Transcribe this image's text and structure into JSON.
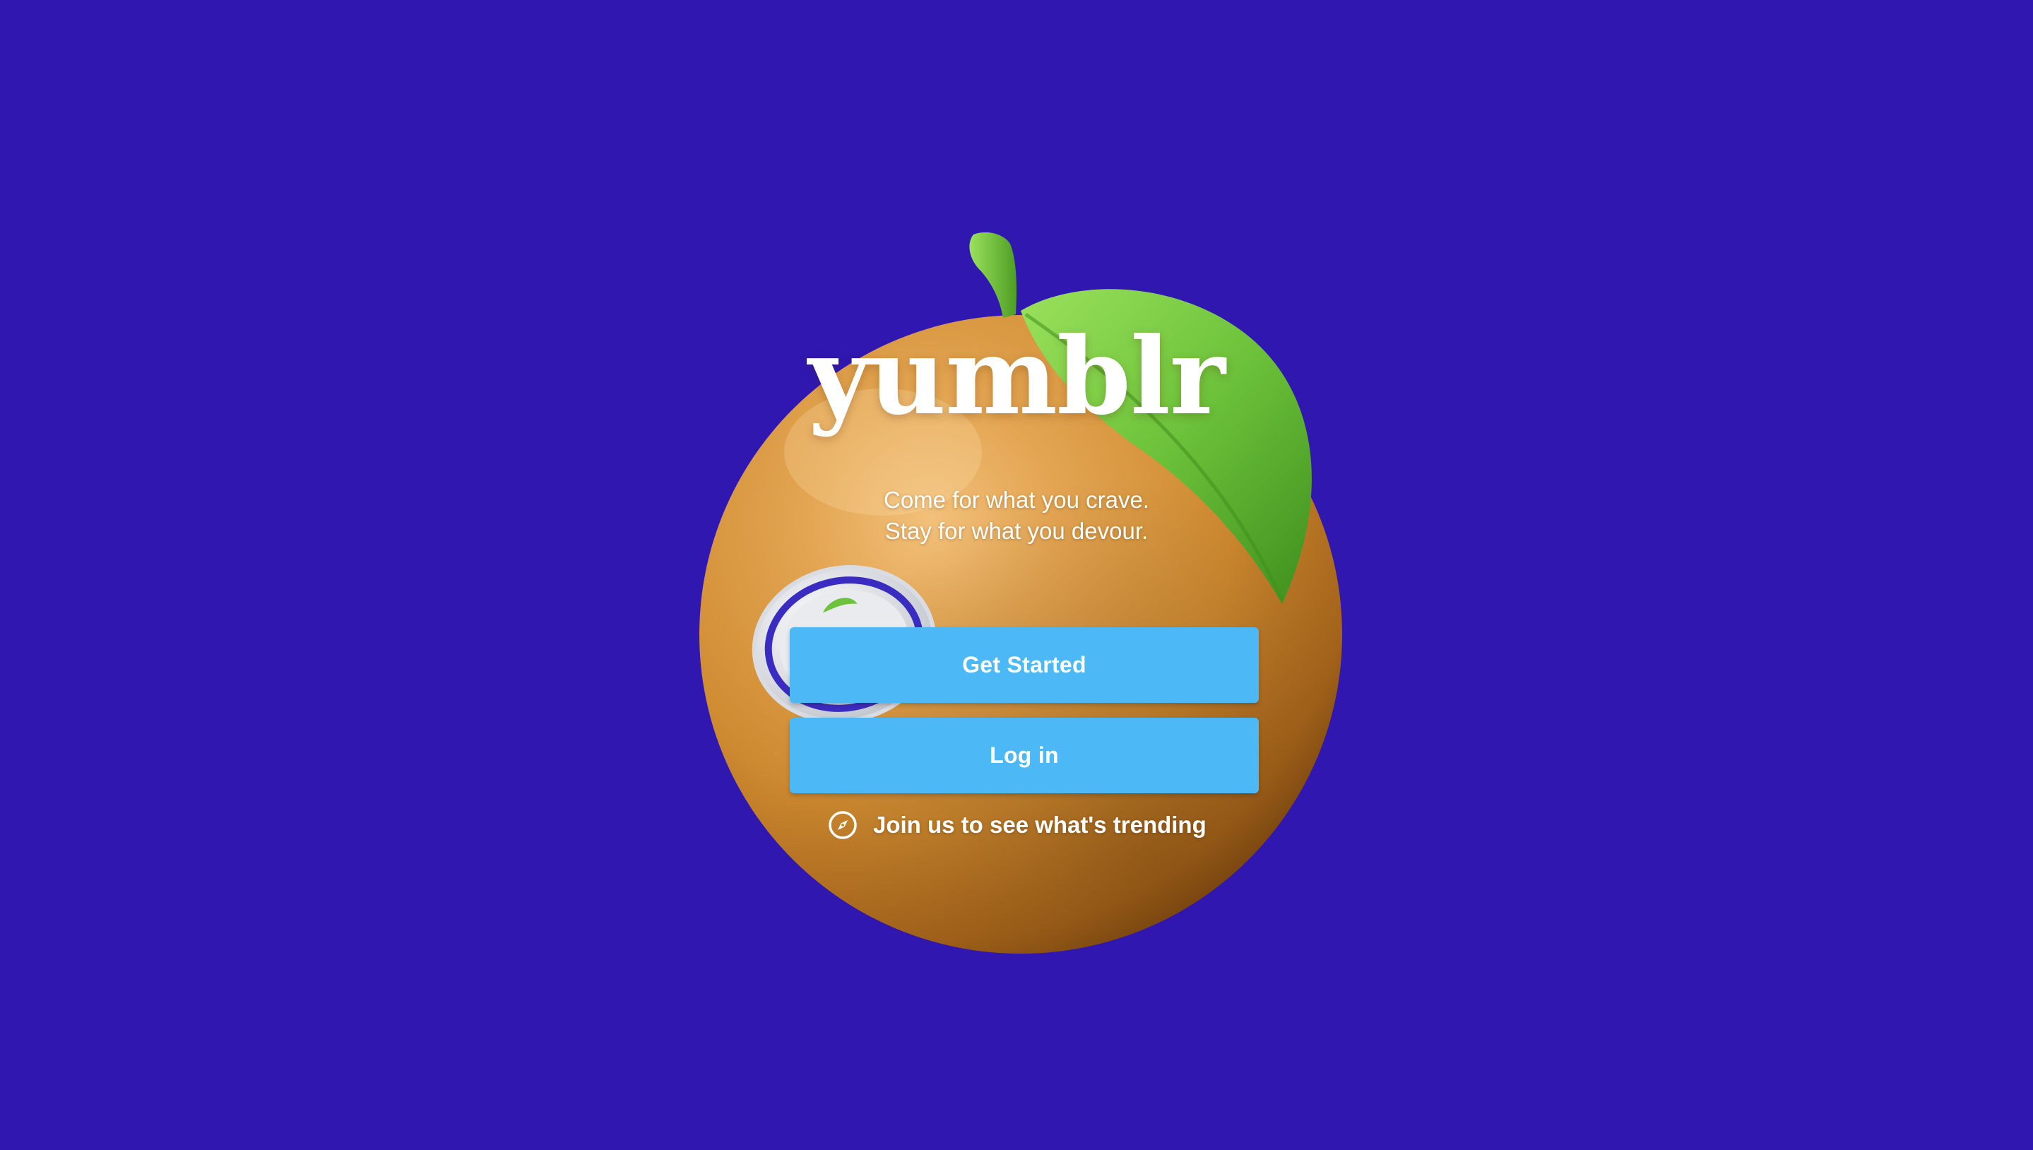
{
  "brand": {
    "name": "yumblr",
    "tagline_line1": "Come for what you crave.",
    "tagline_line2": "Stay for what you devour."
  },
  "actions": {
    "get_started_label": "Get Started",
    "log_in_label": "Log in",
    "explore_label": "Join us to see what's trending",
    "explore_icon": "compass-icon"
  },
  "hero": {
    "illustration": "orange-with-leaf",
    "badge_icon": "apple-icon"
  },
  "colors": {
    "background": "#2F17B0",
    "button": "#4DB8F6",
    "text": "#FFFFFF",
    "orange": "#D08A2E",
    "leaf": "#6CC23A"
  }
}
